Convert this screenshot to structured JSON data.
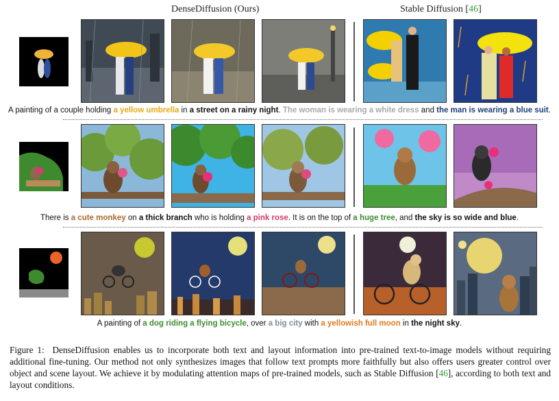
{
  "headers": {
    "dense": "DenseDiffusion (Ours)",
    "sd_prefix": "Stable Diffusion [",
    "sd_ref": "46",
    "sd_suffix": "]"
  },
  "captions": {
    "row1": [
      {
        "text": "A painting of a couple holding ",
        "style": "plain"
      },
      {
        "text": "a yellow umbrella",
        "style": "yellow"
      },
      {
        "text": " in ",
        "style": "plain"
      },
      {
        "text": "a street on a rainy night",
        "style": "black"
      },
      {
        "text": ". ",
        "style": "plain"
      },
      {
        "text": "The woman is wearing a white dress",
        "style": "grey"
      },
      {
        "text": " and ",
        "style": "plain"
      },
      {
        "text": "the man is wearing a blue suit",
        "style": "blue"
      },
      {
        "text": ".",
        "style": "plain"
      }
    ],
    "row2": [
      {
        "text": "There is ",
        "style": "plain"
      },
      {
        "text": "a cute monkey",
        "style": "brown"
      },
      {
        "text": " on ",
        "style": "plain"
      },
      {
        "text": "a thick branch",
        "style": "black"
      },
      {
        "text": " who is holding ",
        "style": "plain"
      },
      {
        "text": "a pink rose",
        "style": "pink"
      },
      {
        "text": ". It is on the top of ",
        "style": "plain"
      },
      {
        "text": "a huge tree",
        "style": "green"
      },
      {
        "text": ", and ",
        "style": "plain"
      },
      {
        "text": "the sky is so wide and blue",
        "style": "black"
      },
      {
        "text": ".",
        "style": "plain"
      }
    ],
    "row3": [
      {
        "text": "A painting of ",
        "style": "plain"
      },
      {
        "text": "a dog riding a flying bicycle",
        "style": "green"
      },
      {
        "text": ", over ",
        "style": "plain"
      },
      {
        "text": "a big city",
        "style": "slate"
      },
      {
        "text": " with ",
        "style": "plain"
      },
      {
        "text": "a yellowish full moon",
        "style": "orange"
      },
      {
        "text": " in ",
        "style": "plain"
      },
      {
        "text": "the night sky",
        "style": "black"
      },
      {
        "text": ".",
        "style": "plain"
      }
    ]
  },
  "figure_caption": {
    "label": "Figure 1:",
    "body_before_ref": "DenseDiffusion enables us to incorporate both text and layout information into pre-trained text-to-image models without requiring additional fine-tuning. Our method not only synthesizes images that follow text prompts more faithfully but also offers users greater control over object and scene layout. We achieve it by modulating attention maps of pre-trained models, such as Stable Diffusion [",
    "ref": "46",
    "body_after_ref": "], according to both text and layout conditions."
  },
  "colors": {
    "yellow": "#e6a817",
    "grey": "#a8a8a8",
    "blue": "#1f3f7a",
    "brown": "#a8692b",
    "pink": "#d23a6b",
    "green": "#3e8a2e",
    "slate": "#7f8a99",
    "orange": "#e07a1e",
    "citation": "#2e9e2e"
  }
}
